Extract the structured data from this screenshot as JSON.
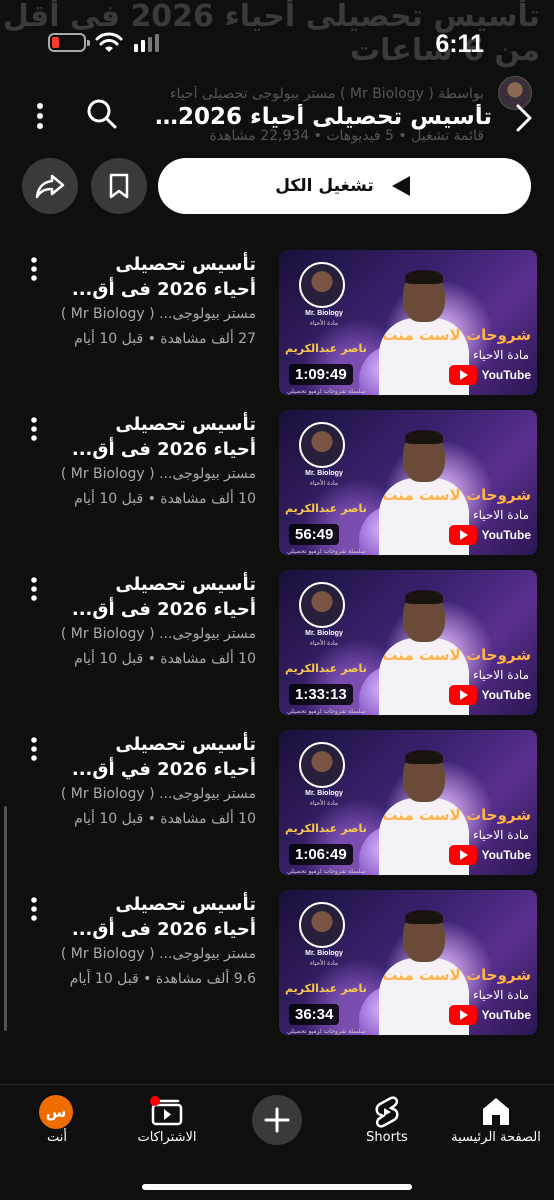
{
  "background_title": "تأسيس تحصيلى أحياء 2026 فى أقل من 6 ساعات",
  "status_bar": {
    "time": "6:11"
  },
  "header": {
    "byline": "بواسطة ( Mr Biology ) مستر بيولوجى تحصيلى أحياء",
    "title": "تأسيس تحصيلى أحياء 2026 ف...",
    "subtitle": "قائمة تشغيل • 5 فيديوهات • 22,934 مشاهدة"
  },
  "actions": {
    "play_all_label": "تشغيل الكل"
  },
  "thumbnail_text": {
    "brand": "Mr. Biology",
    "subtitle": "مادة الأحياء",
    "headline": "شروحات لاست منت",
    "subject": "مادة الاحياء",
    "presenter": "ناصر عبدالكريم",
    "youtube": "YouTube",
    "footer": "سلسلة شروحات لرميو تحصيلي"
  },
  "videos": [
    {
      "title_line1": "تأسيس تحصيلى",
      "title_line2": "أحياء 2026 فى أق...",
      "channel": "مستر بيولوجى... ( Mr Biology )",
      "meta": "27 ألف مشاهدة • قبل 10 أيام",
      "duration": "1:09:49"
    },
    {
      "title_line1": "تأسيس تحصيلى",
      "title_line2": "أحياء 2026 فى أق...",
      "channel": "مستر بيولوجى... ( Mr Biology )",
      "meta": "10 ألف مشاهدة • قبل 10 أيام",
      "duration": "56:49"
    },
    {
      "title_line1": "تأسيس تحصيلى",
      "title_line2": "أحياء 2026 فى أق...",
      "channel": "مستر بيولوجى... ( Mr Biology )",
      "meta": "10 ألف مشاهدة • قبل 10 أيام",
      "duration": "1:33:13"
    },
    {
      "title_line1": "تأسيس تحصيلى",
      "title_line2": "أحياء 2026 في أق...",
      "channel": "مستر بيولوجى... ( Mr Biology )",
      "meta": "10 ألف مشاهدة • قبل 10 أيام",
      "duration": "1:06:49"
    },
    {
      "title_line1": "تأسيس تحصيلى",
      "title_line2": "أحياء 2026 فى أق...",
      "channel": "مستر بيولوجى... ( Mr Biology )",
      "meta": "9.6 ألف مشاهدة • قبل 10 أيام",
      "duration": "36:34"
    }
  ],
  "bottom_nav": {
    "home": "الصفحة الرئيسية",
    "shorts": "Shorts",
    "subscriptions": "الاشتراكات",
    "you": "أنت",
    "you_avatar_letter": "س"
  },
  "colors": {
    "background": "#0f0f0f",
    "accent": "#ff0000",
    "avatar": "#ef6c00"
  },
  "icons": [
    "back-arrow-icon",
    "search-icon",
    "more-vert-icon",
    "play-icon",
    "bookmark-icon",
    "share-icon",
    "home-icon",
    "shorts-icon",
    "plus-icon",
    "subscriptions-icon"
  ]
}
